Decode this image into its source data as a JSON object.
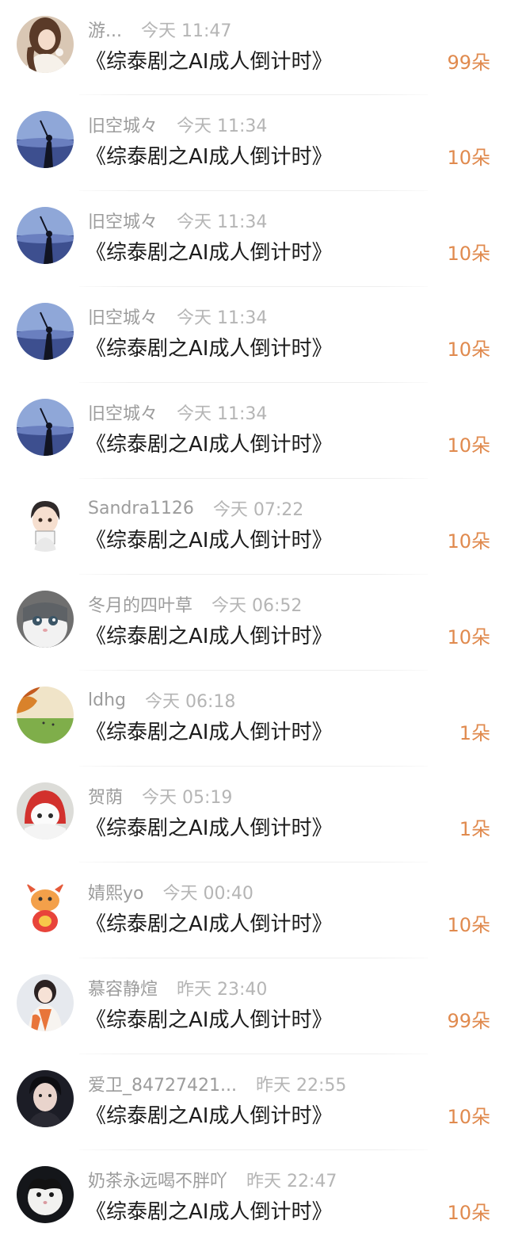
{
  "gifts": [
    {
      "name": "游...",
      "time": "今天 11:47",
      "title": "《综泰剧之AI成人倒计时》",
      "amount": "99朵",
      "avatar": "girl-portrait-avatar"
    },
    {
      "name": "旧空城々",
      "time": "今天 11:34",
      "title": "《综泰剧之AI成人倒计时》",
      "amount": "10朵",
      "avatar": "blue-landscape-avatar"
    },
    {
      "name": "旧空城々",
      "time": "今天 11:34",
      "title": "《综泰剧之AI成人倒计时》",
      "amount": "10朵",
      "avatar": "blue-landscape-avatar"
    },
    {
      "name": "旧空城々",
      "time": "今天 11:34",
      "title": "《综泰剧之AI成人倒计时》",
      "amount": "10朵",
      "avatar": "blue-landscape-avatar"
    },
    {
      "name": "旧空城々",
      "time": "今天 11:34",
      "title": "《综泰剧之AI成人倒计时》",
      "amount": "10朵",
      "avatar": "blue-landscape-avatar"
    },
    {
      "name": "Sandra1126",
      "time": "今天 07:22",
      "title": "《综泰剧之AI成人倒计时》",
      "amount": "10朵",
      "avatar": "cartoon-boy-avatar"
    },
    {
      "name": "冬月的四叶草",
      "time": "今天 06:52",
      "title": "《综泰剧之AI成人倒计时》",
      "amount": "10朵",
      "avatar": "cat-avatar"
    },
    {
      "name": "ldhg",
      "time": "今天 06:18",
      "title": "《综泰剧之AI成人倒计时》",
      "amount": "1朵",
      "avatar": "autumn-field-avatar"
    },
    {
      "name": "贺荫",
      "time": "今天 05:19",
      "title": "《综泰剧之AI成人倒计时》",
      "amount": "1朵",
      "avatar": "cat-red-hood-avatar"
    },
    {
      "name": "婧熙yo",
      "time": "今天 00:40",
      "title": "《综泰剧之AI成人倒计时》",
      "amount": "10朵",
      "avatar": "cartoon-dragon-avatar"
    },
    {
      "name": "慕容静煊",
      "time": "昨天 23:40",
      "title": "《综泰剧之AI成人倒计时》",
      "amount": "99朵",
      "avatar": "hanfu-girl-avatar"
    },
    {
      "name": "爱卫_84727421...",
      "time": "昨天 22:55",
      "title": "《综泰剧之AI成人倒计时》",
      "amount": "10朵",
      "avatar": "young-man-avatar"
    },
    {
      "name": "奶茶永远喝不胖吖",
      "time": "昨天 22:47",
      "title": "《综泰剧之AI成人倒计时》",
      "amount": "10朵",
      "avatar": "black-white-cat-avatar"
    }
  ],
  "colors": {
    "amount": "#e08a4e",
    "title": "#1c1c1c",
    "meta": "#9c9c9c"
  }
}
